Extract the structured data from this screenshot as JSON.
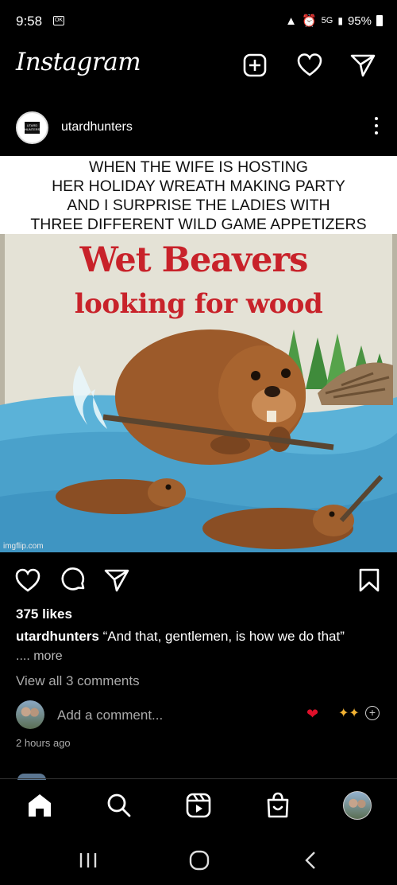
{
  "status": {
    "time": "9:58",
    "notif": "OK",
    "network": "5G",
    "battery": "95%"
  },
  "header": {
    "app_title": "Instagram"
  },
  "post": {
    "account": "utardhunters",
    "account_badge": "UTARD HUNTERS",
    "meme": {
      "caption_lines": [
        "WHEN THE WIFE IS HOSTING",
        "HER HOLIDAY WREATH MAKING PARTY",
        "AND I SURPRISE THE LADIES WITH",
        "THREE DIFFERENT WILD GAME APPETIZERS"
      ],
      "book_title_line1": "Wet Beavers",
      "book_title_line2": "looking for wood",
      "watermark": "imgflip.com"
    },
    "likes": "375 likes",
    "caption_user": "utardhunters",
    "caption_text": "“And that, gentlemen, is how we do that”",
    "more_label": ".... more",
    "view_comments": "View all 3 comments",
    "add_comment_placeholder": "Add a comment...",
    "time_ago": "2 hours ago"
  },
  "quick_reactions": [
    "heart",
    "raised-hands",
    "add"
  ],
  "colors": {
    "background": "#000000",
    "meme_title": "#c8222a",
    "heart_emoji": "#e0102a",
    "secondary_text": "#aaaaaa"
  },
  "icons": {
    "header": [
      "new-post-icon",
      "heart-icon",
      "direct-message-icon"
    ],
    "actions": [
      "like-icon",
      "comment-icon",
      "share-icon",
      "save-icon"
    ],
    "bottom_nav": [
      "home-icon",
      "search-icon",
      "reels-icon",
      "shop-icon",
      "profile-avatar"
    ],
    "android_nav": [
      "recent-apps-icon",
      "home-button-icon",
      "back-icon"
    ]
  }
}
